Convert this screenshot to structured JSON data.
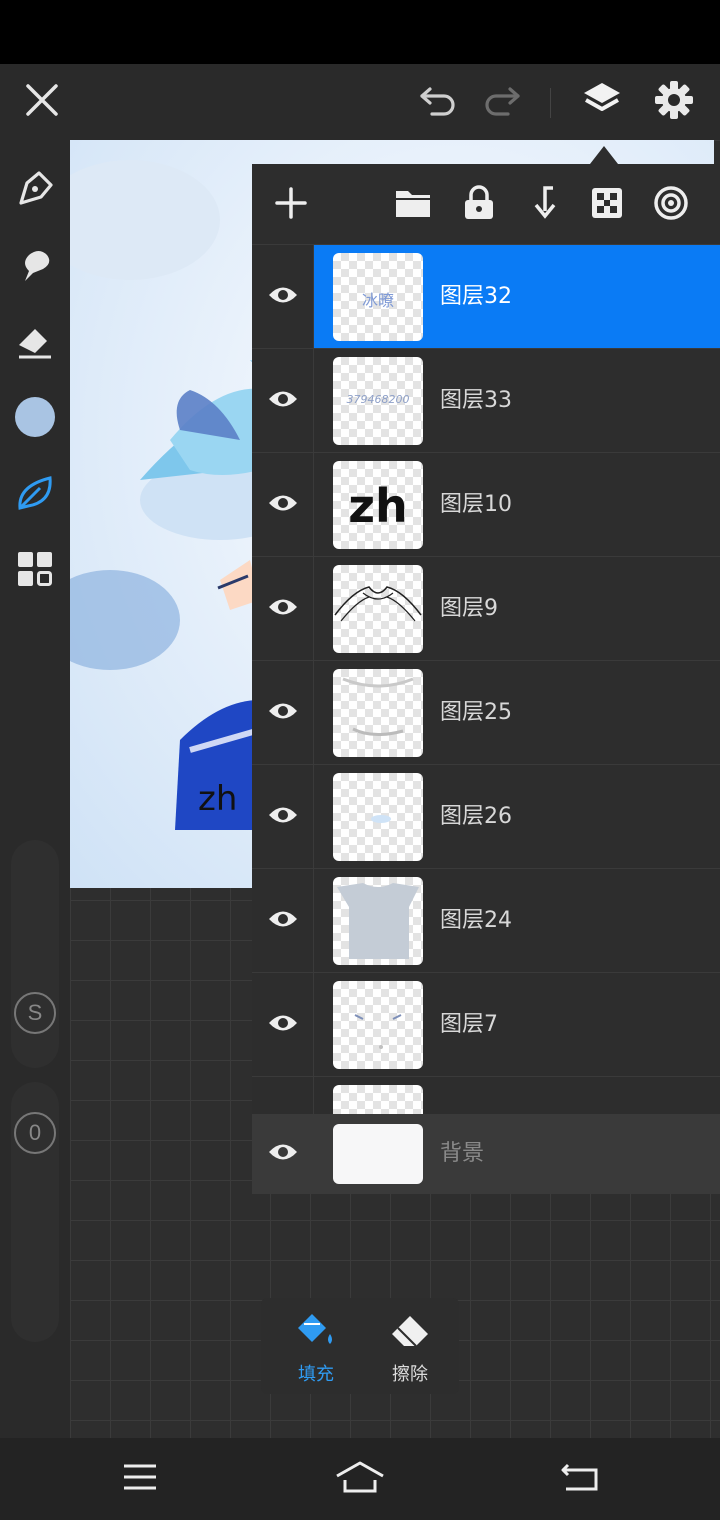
{
  "topbar": {
    "close_icon": "close-icon",
    "undo_icon": "undo-icon",
    "redo_icon": "redo-icon",
    "layers_icon": "layers-icon",
    "settings_icon": "gear-icon"
  },
  "sidebar": {
    "tools": [
      "pen-icon",
      "smudge-icon",
      "eraser-icon",
      "color-swatch",
      "leaf-brush-icon",
      "grid-icon"
    ],
    "color_swatch": "#a9c4e3",
    "active_color": "#2f9bf2",
    "size_knob_label": "S",
    "opacity_knob_label": "0"
  },
  "canvas": {
    "watermark_text": "zh"
  },
  "layers_panel": {
    "toolbar": [
      "add-layer-icon",
      "folder-icon",
      "lock-icon",
      "merge-down-icon",
      "checker-icon",
      "target-icon"
    ],
    "layers": [
      {
        "name": "图层32",
        "thumb_text": "冰暸",
        "selected": true
      },
      {
        "name": "图层33",
        "thumb_text": "379468200",
        "selected": false
      },
      {
        "name": "图层10",
        "thumb_text": "zh",
        "selected": false
      },
      {
        "name": "图层9",
        "thumb_text": "",
        "selected": false
      },
      {
        "name": "图层25",
        "thumb_text": "",
        "selected": false
      },
      {
        "name": "图层26",
        "thumb_text": "",
        "selected": false
      },
      {
        "name": "图层24",
        "thumb_text": "",
        "selected": false
      },
      {
        "name": "图层7",
        "thumb_text": "",
        "selected": false
      }
    ],
    "background_layer": "背景",
    "selected_color": "#0a7bf5"
  },
  "bottom_tools": {
    "fill_label": "填充",
    "erase_label": "擦除",
    "active_color": "#2f9bf2"
  },
  "navbar": {
    "menu_icon": "menu-icon",
    "home_icon": "home-icon",
    "back_icon": "back-icon"
  }
}
